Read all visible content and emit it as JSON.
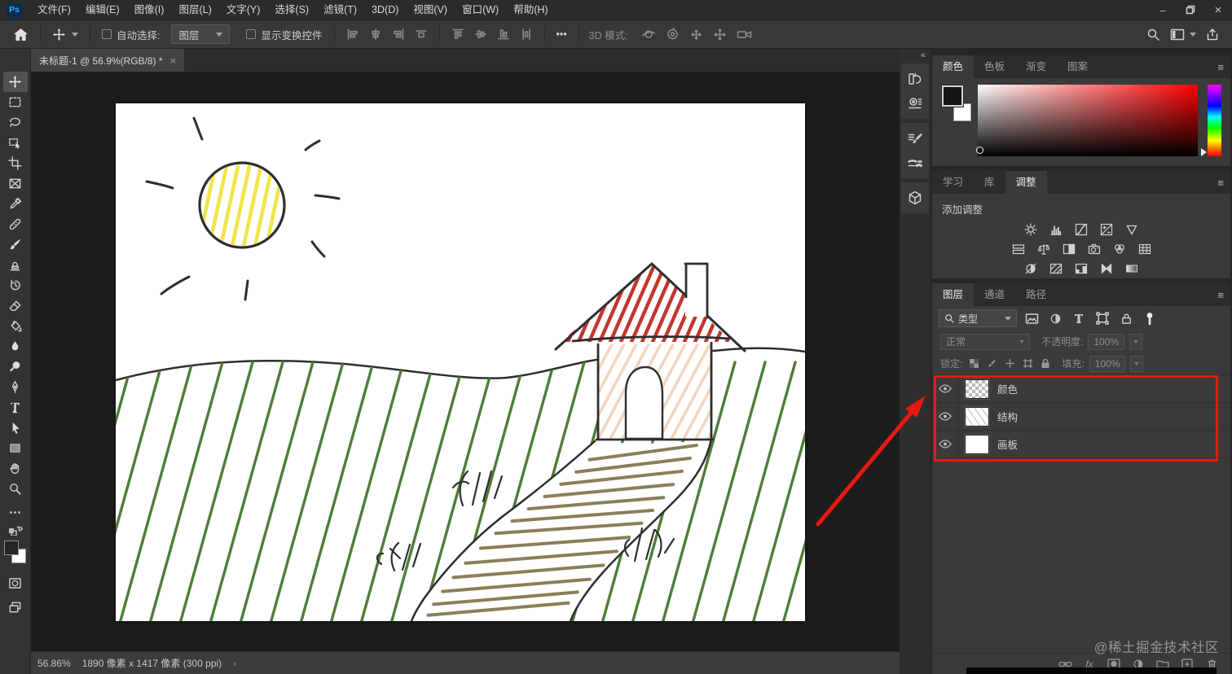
{
  "menu_bar": {
    "logo": "Ps",
    "items": [
      "文件(F)",
      "编辑(E)",
      "图像(I)",
      "图层(L)",
      "文字(Y)",
      "选择(S)",
      "滤镜(T)",
      "3D(D)",
      "视图(V)",
      "窗口(W)",
      "帮助(H)"
    ],
    "window_controls": [
      "minimize",
      "restore",
      "close"
    ]
  },
  "options_bar": {
    "auto_select_label": "自动选择:",
    "auto_select_value": "图层",
    "show_transform_label": "显示变换控件",
    "ellipsis": "•••",
    "mode_3d_label": "3D 模式:",
    "right_icons": [
      "search",
      "workspace-switcher",
      "share"
    ]
  },
  "document_tab": {
    "title": "未标题-1 @ 56.9%(RGB/8) *",
    "close_glyph": "×"
  },
  "toolbar": {
    "tools": [
      "move",
      "rectangular-marquee",
      "lasso",
      "object-selection",
      "crop",
      "frame",
      "eyedropper",
      "spot-healing-brush",
      "brush",
      "clone-stamp",
      "history-brush",
      "eraser",
      "gradient",
      "blur",
      "dodge",
      "pen",
      "type",
      "path-selection",
      "rectangle",
      "hand",
      "zoom"
    ],
    "selected_tool": "move"
  },
  "icon_strip": [
    "history",
    "properties",
    "brush-settings",
    "brushes",
    "3d"
  ],
  "panels": {
    "color": {
      "tabs": [
        "颜色",
        "色板",
        "渐变",
        "图案"
      ],
      "active_tab": "颜色",
      "menu_glyph": "≡"
    },
    "adjustments": {
      "tabs": [
        "学习",
        "库",
        "调整"
      ],
      "active_tab": "调整",
      "add_label": "添加调整",
      "menu_glyph": "≡",
      "icons": [
        "brightness-contrast",
        "levels",
        "curves",
        "exposure",
        "vibrance",
        "hue-saturation",
        "color-balance",
        "black-white",
        "photo-filter",
        "channel-mixer",
        "color-lookup",
        "invert",
        "posterize",
        "threshold",
        "selective-color",
        "gradient-map"
      ]
    },
    "layers": {
      "tabs": [
        "图层",
        "通道",
        "路径"
      ],
      "active_tab": "图层",
      "menu_glyph": "≡",
      "filter_value": "类型",
      "filter_icons": [
        "pixel-layer-filter",
        "adjustment-layer-filter",
        "type-layer-filter",
        "shape-layer-filter",
        "smart-object-filter",
        "filter-toggle"
      ],
      "blend_mode": "正常",
      "opacity_label": "不透明度:",
      "opacity_value": "100%",
      "lock_label": "锁定:",
      "fill_label": "填充:",
      "fill_value": "100%",
      "items": [
        {
          "name": "颜色",
          "thumb": "transparent-checker",
          "visible": true
        },
        {
          "name": "结构",
          "thumb": "white-sketch",
          "visible": true
        },
        {
          "name": "画板",
          "thumb": "white",
          "visible": true
        }
      ],
      "bottom_icons": [
        "link",
        "fx",
        "layer-mask",
        "adjustment",
        "group",
        "new-layer",
        "delete"
      ]
    }
  },
  "status_bar": {
    "zoom": "56.86%",
    "dimensions": "1890 像素 x 1417 像素 (300 ppi)",
    "chevron": "›"
  },
  "watermark": "@稀土掘金技术社区",
  "drawing": {
    "ink": "#2e2e2e",
    "sun_hatch": "#f0e549",
    "grass": "#4e7d38",
    "roof": "#c4352e",
    "wall_hatch": "#f2d6bf",
    "path_hatch": "#8b7f58",
    "annotation_red": "#e8190f"
  }
}
